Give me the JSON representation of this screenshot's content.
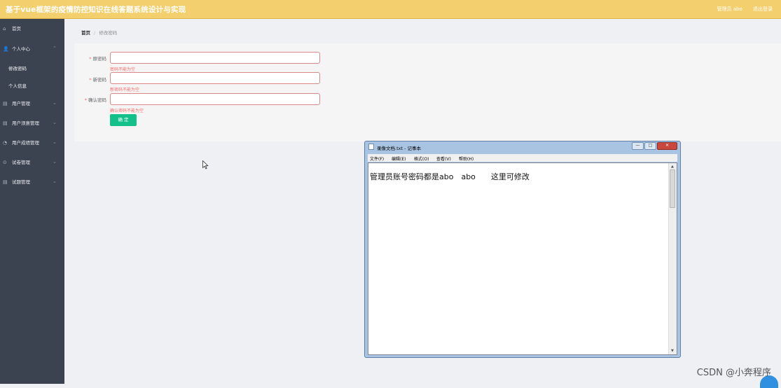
{
  "header": {
    "title": "基于vue框架的疫情防控知识在线答题系统设计与实现",
    "user_label": "管理员 abo",
    "logout_label": "退出登录"
  },
  "sidebar": {
    "items": [
      {
        "label": "首页",
        "icon": "home-icon"
      },
      {
        "label": "个人中心",
        "icon": "user-icon"
      },
      {
        "label": "修改密码"
      },
      {
        "label": "个人信息"
      },
      {
        "label": "用户管理",
        "icon": "list-icon"
      },
      {
        "label": "用户须意管理",
        "icon": "list-icon"
      },
      {
        "label": "用户成绩管理",
        "icon": "chart-icon"
      },
      {
        "label": "试卷管理",
        "icon": "pin-icon"
      },
      {
        "label": "试题管理",
        "icon": "list-icon"
      }
    ]
  },
  "breadcrumb": {
    "home": "首页",
    "separator": "/",
    "current": "修改密码"
  },
  "form": {
    "fields": [
      {
        "label": "原密码",
        "value": "",
        "error": "密码不能为空"
      },
      {
        "label": "新密码",
        "value": "",
        "error": "新密码不能为空"
      },
      {
        "label": "确认密码",
        "value": "",
        "error": "确认密码不能为空"
      }
    ],
    "required_mark": "*",
    "submit_label": "确 定"
  },
  "notepad": {
    "title": "录像文档.txt - 记事本",
    "menu": [
      "文件(F)",
      "编辑(E)",
      "格式(O)",
      "查看(V)",
      "帮助(H)"
    ],
    "content": "管理员账号密码都是abo　abo　　这里可修改",
    "minimize": "—",
    "maximize": "□",
    "close": "✕"
  },
  "watermark": "CSDN @小奔程序",
  "colors": {
    "topbar": "#f4cf6d",
    "sidebar": "#3c4350",
    "submit": "#13c08a",
    "error": "#f56c6c"
  }
}
